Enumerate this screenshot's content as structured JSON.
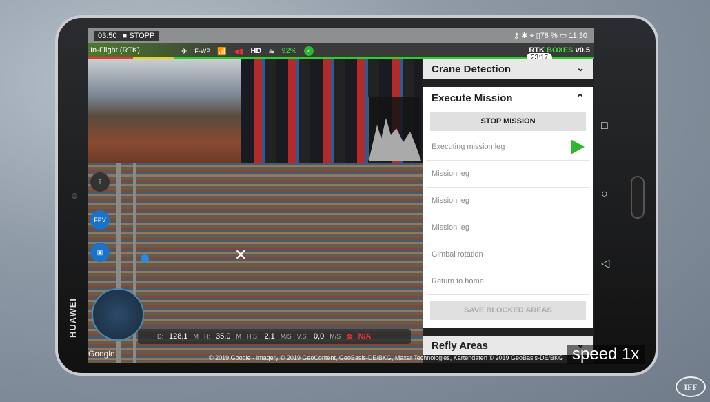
{
  "device": {
    "brand": "HUAWEI"
  },
  "status_bar": {
    "recording_time": "03:50",
    "stop_label": "STOPP",
    "battery": "78 %",
    "clock": "11:30"
  },
  "flight_bar": {
    "mode": "In-Flight (RTK)",
    "waypoint_mode": "F-WP",
    "video_link": "HD",
    "battery": "92%",
    "app_prefix": "RTK",
    "app_name": "BOXES",
    "version": "v0.5",
    "time_remaining": "23:17"
  },
  "telemetry": {
    "d_label": "D:",
    "d_value": "128,1",
    "d_unit": "M",
    "h_label": "H:",
    "h_value": "35,0",
    "h_unit": "M",
    "hs_label": "H.S.",
    "hs_value": "2,1",
    "hs_unit": "M/S",
    "vs_label": "V.S.",
    "vs_value": "0,0",
    "vs_unit": "M/S",
    "rtk_status": "N/A"
  },
  "map": {
    "google": "Google",
    "copyright": "© 2019 Google · Imagery © 2019 GeoContent, GeoBasis-DE/BKG, Maxar Technologies, Kartendaten © 2019 GeoBasis-DE/BKG"
  },
  "left_tools": {
    "fpv": "FPV"
  },
  "panel": {
    "crane_detection": "Crane Detection",
    "execute_mission": "Execute Mission",
    "stop_mission": "STOP MISSION",
    "legs": [
      "Executing mission leg",
      "Mission leg",
      "Mission leg",
      "Mission leg",
      "Gimbal rotation",
      "Return to home"
    ],
    "save_blocked": "SAVE BLOCKED AREAS",
    "refly_areas": "Refly Areas"
  },
  "overlay": {
    "speed": "speed 1x",
    "logo": "IFF"
  },
  "colors": {
    "accent_green": "#2fb52f",
    "rtk_red": "#e33333"
  }
}
